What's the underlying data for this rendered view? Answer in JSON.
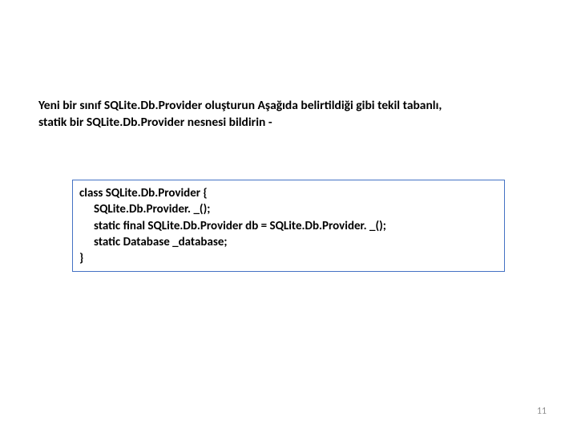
{
  "description": {
    "line1": "Yeni bir sınıf SQLite.Db.Provider oluşturun Aşağıda belirtildiği gibi tekil tabanlı,",
    "line2": "statik bir SQLite.Db.Provider nesnesi bildirin -"
  },
  "code": {
    "l1": "class SQLite.Db.Provider {",
    "l2": "SQLite.Db.Provider. _();",
    "l3": "static final SQLite.Db.Provider db = SQLite.Db.Provider. _();",
    "l4": "static Database _database;",
    "l5": "}"
  },
  "page_number": "11"
}
